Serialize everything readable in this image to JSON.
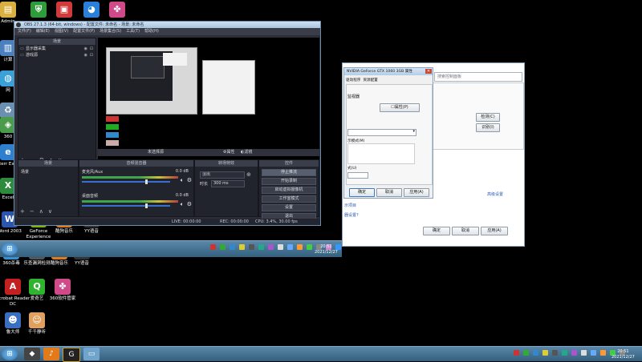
{
  "desktop": {
    "icons_left": [
      {
        "label": "Admin",
        "color": "#d9b040",
        "glyph": "▤"
      },
      {
        "label": "计算",
        "color": "#4a7fc0",
        "glyph": "▥"
      },
      {
        "label": "网",
        "color": "#3aa0d8",
        "glyph": "◍"
      },
      {
        "label": "回",
        "color": "#6b8fb0",
        "glyph": "♻"
      },
      {
        "label": "360",
        "color": "#4a9b4a",
        "glyph": "◈"
      },
      {
        "label": "Interr Explo",
        "color": "#2f7fd0",
        "glyph": "e"
      },
      {
        "label": "Excel",
        "color": "#2e8b3e",
        "glyph": "X"
      },
      {
        "label": "Word 2003",
        "color": "#2a56b0",
        "glyph": "W"
      }
    ],
    "icons_top": [
      {
        "label": "",
        "color": "#2f9b3a",
        "glyph": "⛨"
      },
      {
        "label": "",
        "color": "#d03a3a",
        "glyph": "▣"
      },
      {
        "label": "",
        "color": "#2a7fd8",
        "glyph": "◕"
      },
      {
        "label": "",
        "color": "#d04a8a",
        "glyph": "✤"
      }
    ],
    "icons_row": [
      {
        "label": "GeForce Experience",
        "color": "#76b900",
        "glyph": "◉"
      },
      {
        "label": "酷狗音乐",
        "color": "#e07a1a",
        "glyph": "♪"
      },
      {
        "label": "YY语音",
        "color": "#333333",
        "glyph": "G"
      }
    ],
    "icons_bottom": [
      {
        "label": "360杀毒",
        "color": "#3a8fd0",
        "glyph": "◐"
      },
      {
        "label": "乐查漏洞检测",
        "color": "#555555",
        "glyph": "◆"
      },
      {
        "label": "酷狗音乐",
        "color": "#e07a1a",
        "glyph": "♪"
      },
      {
        "label": "YY语音",
        "color": "#333333",
        "glyph": "G"
      },
      {
        "label": "Acrobat Reader DC",
        "color": "#c42020",
        "glyph": "A"
      },
      {
        "label": "爱奇艺",
        "color": "#2fb42f",
        "glyph": "Q"
      },
      {
        "label": "360软件管家",
        "color": "#d04a8a",
        "glyph": "✤"
      },
      {
        "label": "鲁大师",
        "color": "#3a6fc0",
        "glyph": "☻"
      },
      {
        "label": "千千静听",
        "color": "#e0a060",
        "glyph": "☺"
      }
    ]
  },
  "obs": {
    "title": "OBS 27.1.3 (64-bit, windows) - 配置文件: 未命名 - 场景: 未命名",
    "menu": [
      "文件(F)",
      "编辑(E)",
      "视图(V)",
      "配置文件(P)",
      "场景集合(S)",
      "工具(T)",
      "帮助(H)"
    ],
    "scenes_header": "场景",
    "scene_items": [
      "显示器采集",
      "游戏源"
    ],
    "no_source_label": "未选择源",
    "properties_btn": "属性",
    "filters_btn": "滤镜",
    "mixer_header": "音频混音器",
    "scenes_panel_header": "场景",
    "transitions_header": "转场特效",
    "controls_header": "控件",
    "scene_list": [
      "场景"
    ],
    "mixer_tracks": [
      {
        "name": "麦克风/Aux",
        "db": "0.0 dB",
        "level": 0.72
      },
      {
        "name": "桌面音频",
        "db": "0.0 dB",
        "level": 0.72
      }
    ],
    "transition_type": "淡出",
    "duration_label": "时长",
    "duration_value": "300 ms",
    "controls": [
      "停止推流",
      "开始录制",
      "启动虚拟摄像机",
      "工作室模式",
      "设置",
      "退出"
    ],
    "status": {
      "live": "LIVE: 00:00:00",
      "rec": "REC: 00:00:00",
      "cpu": "CPU: 3.4%, 30.00 fps"
    },
    "panel_buttons": [
      "+",
      "−",
      "⚙",
      "∧",
      "∨"
    ]
  },
  "settings_dialog": {
    "title": "NVIDIA GeForce GTX 1060 3GB 属性",
    "tabs": [
      "驱动程序",
      "资源配置"
    ],
    "section1": "监视器",
    "props_btn": "属性(P)",
    "mode_value": "",
    "note1": "示模式(M)",
    "note2": "式(U)",
    "ok": "确定",
    "cancel": "取消",
    "apply": "应用(A)"
  },
  "back_window": {
    "search_placeholder": "搜索控制面板",
    "detect_btn": "检测(C)",
    "identify_btn": "识别(I)",
    "adv_link": "高级设置",
    "link1": "示项目",
    "link2": "器设置?",
    "ok": "确定",
    "cancel": "取消",
    "apply": "应用(A)"
  },
  "inner_taskbar": {
    "time": "20:51",
    "date": "2021/12/27"
  },
  "taskbar": {
    "time": "20:51",
    "date": "2021/12/27"
  }
}
